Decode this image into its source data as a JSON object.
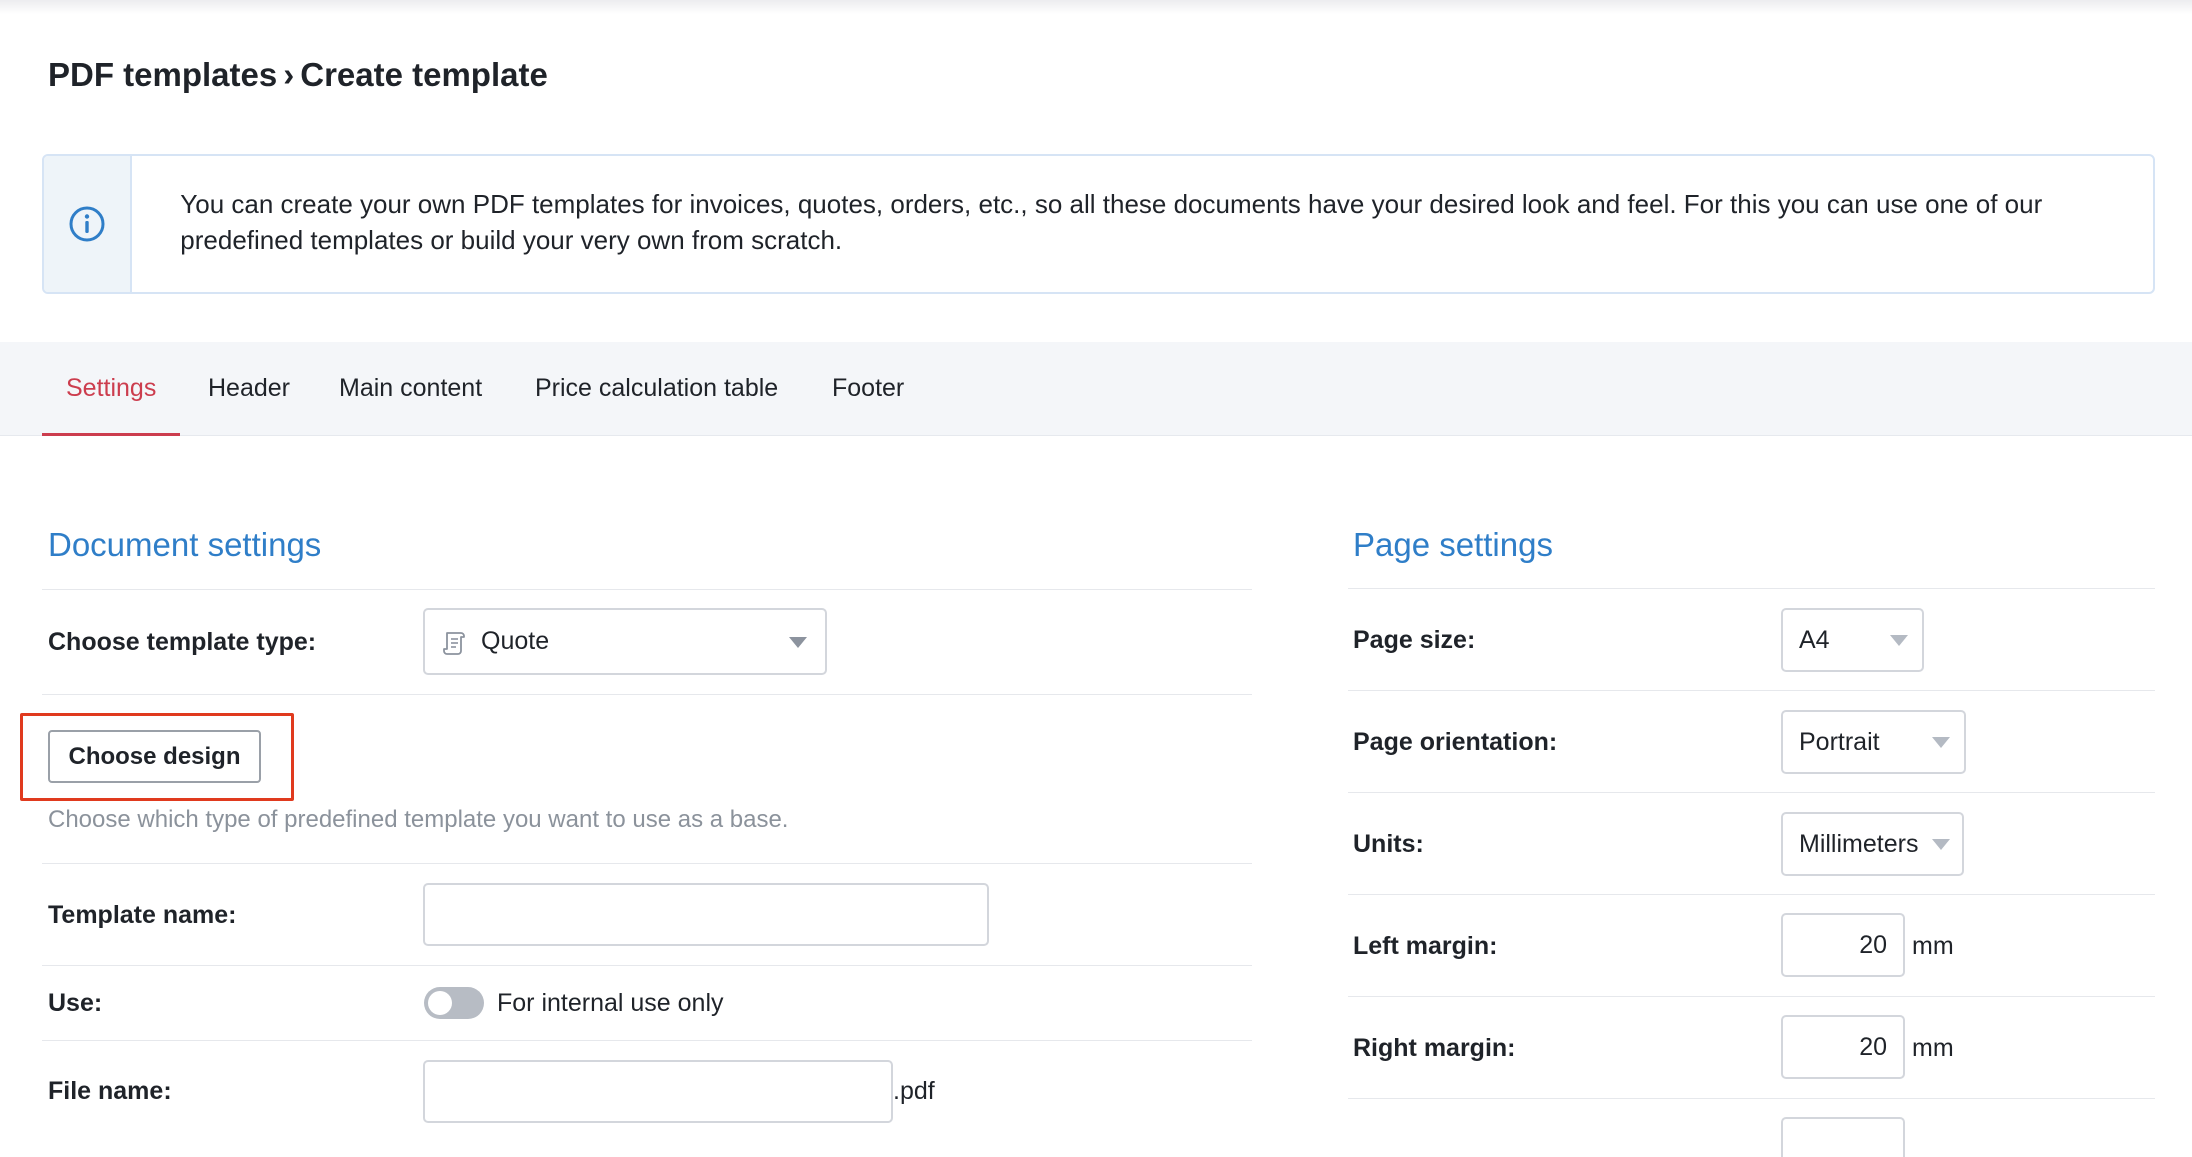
{
  "breadcrumb": {
    "parent": "PDF templates",
    "separator": "›",
    "current": "Create template"
  },
  "info": {
    "icon": "info-circle-icon",
    "text": "You can create your own PDF templates for invoices, quotes, orders, etc., so all these documents have your desired look and feel. For this you can use one of our predefined templates or build your very own from scratch."
  },
  "tabs": [
    {
      "label": "Settings",
      "active": true
    },
    {
      "label": "Header",
      "active": false
    },
    {
      "label": "Main content",
      "active": false
    },
    {
      "label": "Price calculation table",
      "active": false
    },
    {
      "label": "Footer",
      "active": false
    }
  ],
  "document_settings": {
    "title": "Document settings",
    "template_type_label": "Choose template type:",
    "template_type_value": "Quote",
    "template_type_icon": "document-scroll-icon",
    "choose_design_label": "Choose design",
    "choose_design_hint": "Choose which type of predefined template you want to use as a base.",
    "template_name_label": "Template name:",
    "template_name_value": "",
    "use_label": "Use:",
    "use_toggle_label": "For internal use only",
    "use_toggle_on": false,
    "file_name_label": "File name:",
    "file_name_value": "",
    "file_name_suffix": ".pdf"
  },
  "page_settings": {
    "title": "Page settings",
    "page_size_label": "Page size:",
    "page_size_value": "A4",
    "orientation_label": "Page orientation:",
    "orientation_value": "Portrait",
    "units_label": "Units:",
    "units_value": "Millimeters",
    "left_margin_label": "Left margin:",
    "left_margin_value": "20",
    "left_margin_unit": "mm",
    "right_margin_label": "Right margin:",
    "right_margin_value": "20",
    "right_margin_unit": "mm"
  },
  "colors": {
    "accent_tab": "#cc3d4e",
    "section_title": "#2f7ec8",
    "highlight": "#e03a1e"
  }
}
